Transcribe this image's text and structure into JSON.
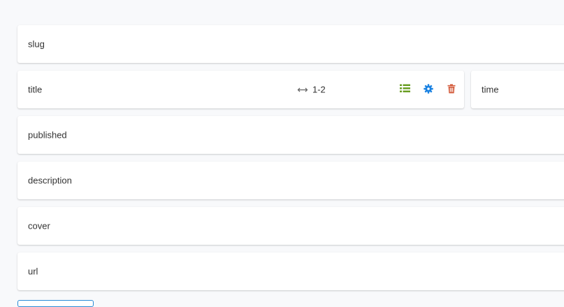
{
  "rows": {
    "slug": "slug",
    "title": "title",
    "time": "time",
    "published": "published",
    "description": "description",
    "cover": "cover",
    "url": "url"
  },
  "title_row": {
    "span": "1-2",
    "icons": {
      "list": "list-icon",
      "settings": "gear-icon",
      "delete": "trash-icon"
    }
  },
  "colors": {
    "list_icon": "#6a9e23",
    "gear_icon": "#1a82e2",
    "trash_icon": "#d35a3a"
  }
}
